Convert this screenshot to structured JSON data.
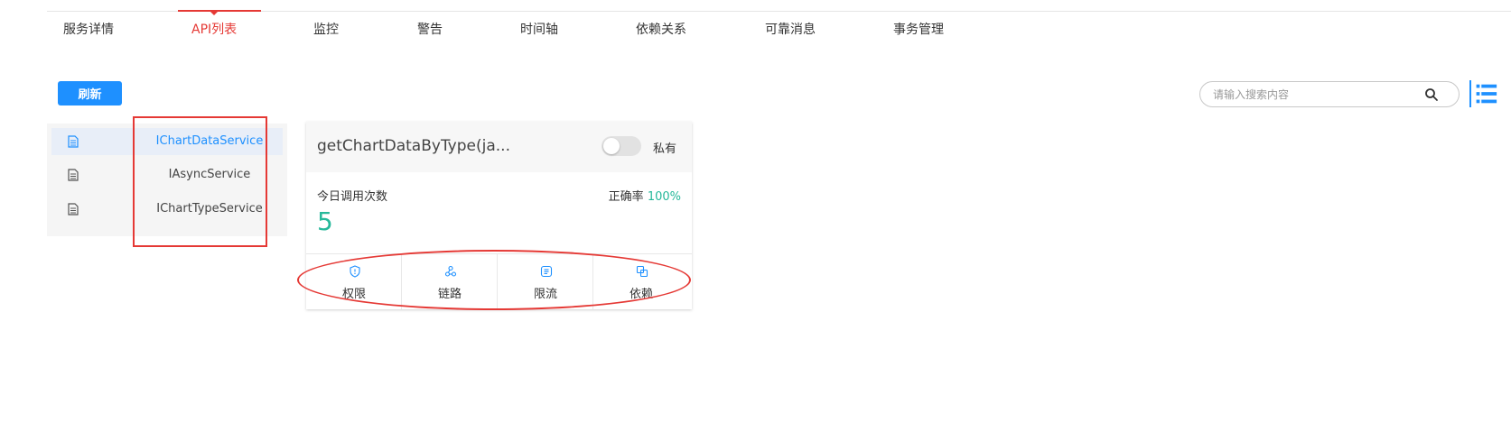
{
  "tabs": [
    {
      "label": "服务详情"
    },
    {
      "label": "API列表"
    },
    {
      "label": "监控"
    },
    {
      "label": "警告"
    },
    {
      "label": "时间轴"
    },
    {
      "label": "依赖关系"
    },
    {
      "label": "可靠消息"
    },
    {
      "label": "事务管理"
    }
  ],
  "toolbar": {
    "refresh_label": "刷新",
    "search_placeholder": "请输入搜索内容"
  },
  "services": [
    {
      "name": "IChartDataService",
      "selected": true
    },
    {
      "name": "IAsyncService",
      "selected": false
    },
    {
      "name": "IChartTypeService",
      "selected": false
    }
  ],
  "api_card": {
    "title": "getChartDataByType(ja...",
    "private_label": "私有",
    "private_enabled": false,
    "calls_label": "今日调用次数",
    "calls_value": "5",
    "accuracy_label": "正确率",
    "accuracy_value": "100%",
    "actions": [
      {
        "label": "权限",
        "icon": "shield-icon"
      },
      {
        "label": "链路",
        "icon": "trace-icon"
      },
      {
        "label": "限流",
        "icon": "limit-icon"
      },
      {
        "label": "依赖",
        "icon": "dependency-icon"
      }
    ]
  },
  "colors": {
    "accent": "#1e90ff",
    "active_tab": "#e53935",
    "highlight_green": "#26b89a",
    "annotation_red": "#e53935"
  }
}
